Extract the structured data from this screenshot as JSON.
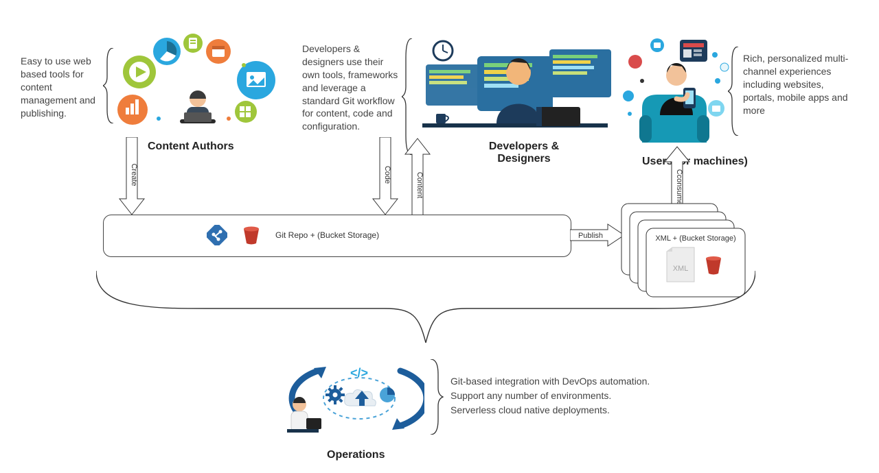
{
  "authors": {
    "title": "Content Authors",
    "desc": "Easy to use web based tools for content management and publishing."
  },
  "developers": {
    "title": "Developers & Designers",
    "desc": "Developers & designers use their own tools, frameworks and leverage a standard Git workflow for content, code and configuration."
  },
  "users": {
    "title": "Users (or machines)",
    "desc": "Rich, personalized multi-channel experiences including websites, portals, mobile apps and more"
  },
  "repo": {
    "label": "Git Repo + (Bucket Storage)"
  },
  "arrows": {
    "create": "Create",
    "code": "Code",
    "content": "Content",
    "publish": "Publish",
    "consume": "Cconsume"
  },
  "delivery": {
    "label": "XML + (Bucket Storage)"
  },
  "operations": {
    "title": "Operations",
    "line1": "Git-based integration with DevOps automation.",
    "line2": "Support any number of environments.",
    "line3": "Serverless cloud native deployments."
  }
}
